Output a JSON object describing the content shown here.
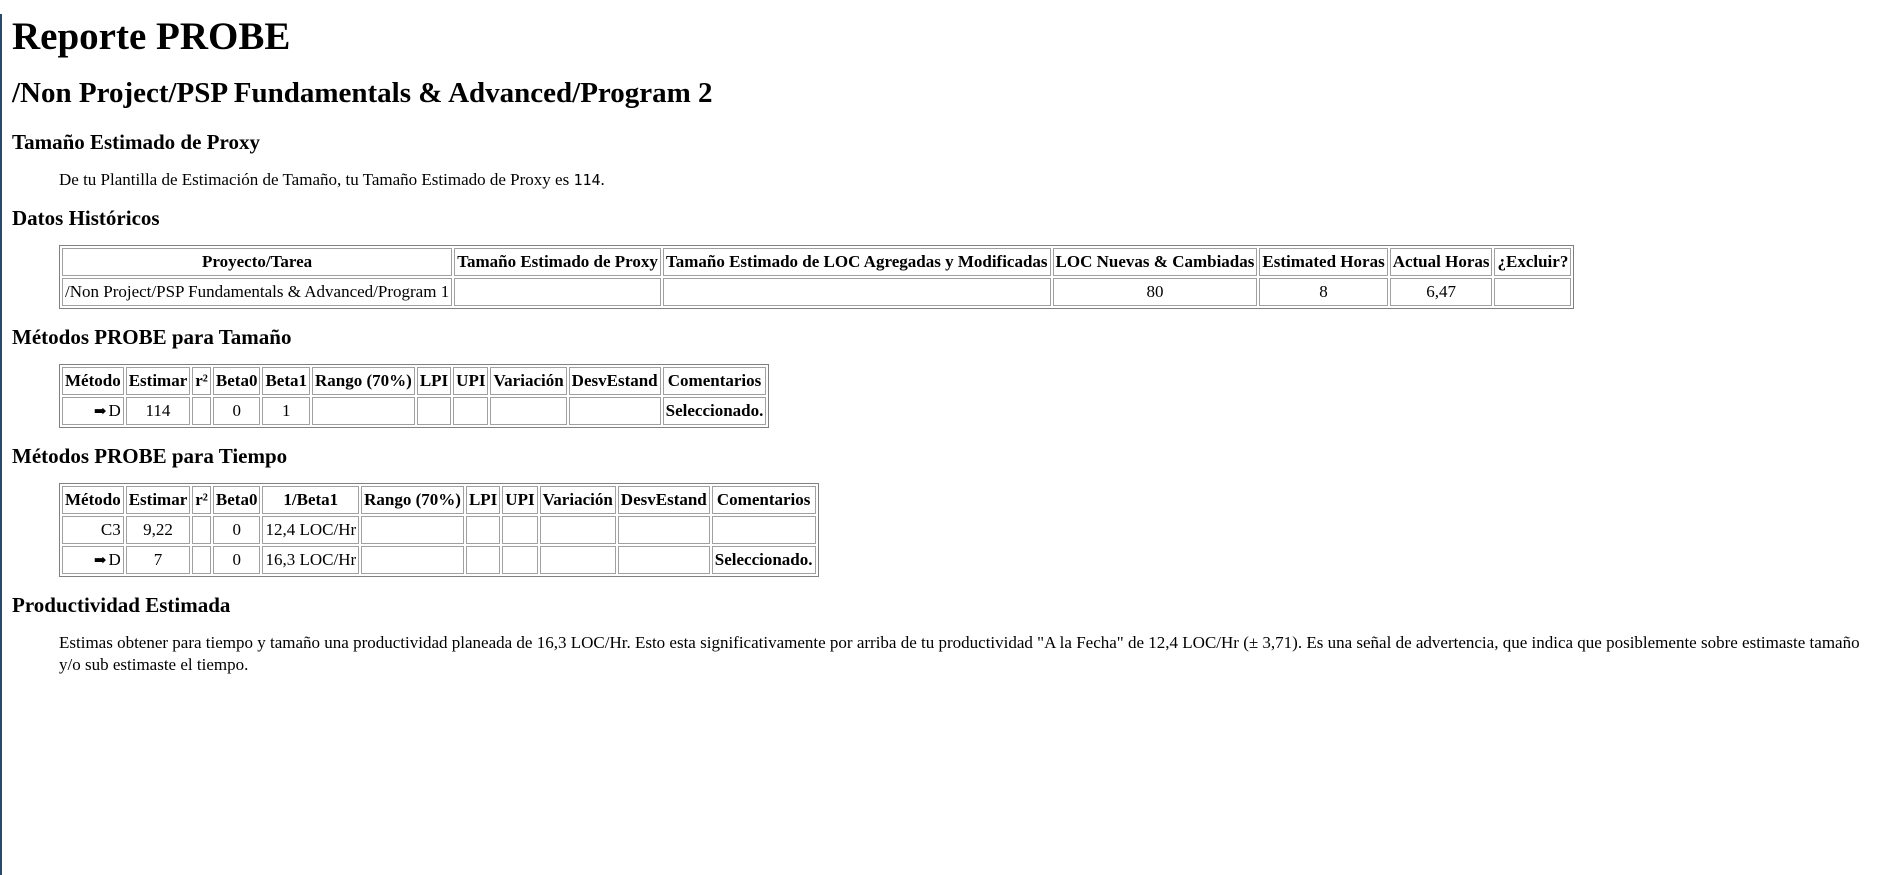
{
  "title": "Reporte PROBE",
  "path": "/Non Project/PSP Fundamentals & Advanced/Program 2",
  "proxy_section": {
    "heading": "Tamaño Estimado de Proxy",
    "text_before": "De tu Plantilla de Estimación de Tamaño, tu Tamaño Estimado de Proxy es ",
    "value": "114",
    "text_after": "."
  },
  "history": {
    "heading": "Datos Históricos",
    "headers": [
      "Proyecto/Tarea",
      "Tamaño Estimado de Proxy",
      "Tamaño Estimado de LOC Agregadas y Modificadas",
      "LOC Nuevas & Cambiadas",
      "Estimated Horas",
      "Actual Horas",
      "¿Excluir?"
    ],
    "rows": [
      [
        "/Non Project/PSP Fundamentals & Advanced/Program 1",
        "",
        "",
        "80",
        "8",
        "6,47",
        ""
      ]
    ]
  },
  "size_methods": {
    "heading": "Métodos PROBE para Tamaño",
    "headers": [
      "Método",
      "Estimar",
      "r²",
      "Beta0",
      "Beta1",
      "Rango (70%)",
      "LPI",
      "UPI",
      "Variación",
      "DesvEstand",
      "Comentarios"
    ],
    "rows": [
      {
        "arrow": "➡",
        "metodo": "D",
        "estimar": "114",
        "r2": "",
        "beta0": "0",
        "beta1": "1",
        "rango": "",
        "lpi": "",
        "upi": "",
        "variacion": "",
        "desv": "",
        "comentarios": "Seleccionado."
      }
    ]
  },
  "time_methods": {
    "heading": "Métodos PROBE para Tiempo",
    "headers": [
      "Método",
      "Estimar",
      "r²",
      "Beta0",
      "1/Beta1",
      "Rango (70%)",
      "LPI",
      "UPI",
      "Variación",
      "DesvEstand",
      "Comentarios"
    ],
    "rows": [
      {
        "arrow": "",
        "metodo": "C3",
        "estimar": "9,22",
        "r2": "",
        "beta0": "0",
        "beta1": "12,4 LOC/Hr",
        "rango": "",
        "lpi": "",
        "upi": "",
        "variacion": "",
        "desv": "",
        "comentarios": ""
      },
      {
        "arrow": "➡",
        "metodo": "D",
        "estimar": "7",
        "r2": "",
        "beta0": "0",
        "beta1": "16,3 LOC/Hr",
        "rango": "",
        "lpi": "",
        "upi": "",
        "variacion": "",
        "desv": "",
        "comentarios": "Seleccionado."
      }
    ]
  },
  "productivity": {
    "heading": "Productividad Estimada",
    "text": "Estimas obtener para tiempo y tamaño una productividad planeada de 16,3 LOC/Hr. Esto esta significativamente por arriba de tu productividad \"A la Fecha\" de 12,4 LOC/Hr (± 3,71). Es una señal de advertencia, que indica que posiblemente sobre estimaste tamaño y/o sub estimaste el tiempo."
  }
}
